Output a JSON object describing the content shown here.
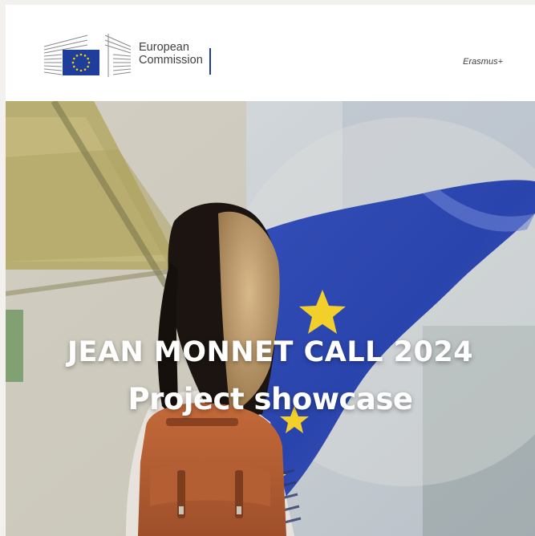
{
  "header": {
    "logo": {
      "line1": "European",
      "line2": "Commission"
    },
    "program": "Erasmus+"
  },
  "hero": {
    "title": "JEAN MONNET CALL 2024",
    "subtitle": "Project showcase",
    "image_description_icon": "student-with-eu-flag-photo"
  },
  "colors": {
    "eu_blue": "#1f3e9b",
    "eu_star": "#f5d000",
    "hero_text": "#ffffff"
  }
}
